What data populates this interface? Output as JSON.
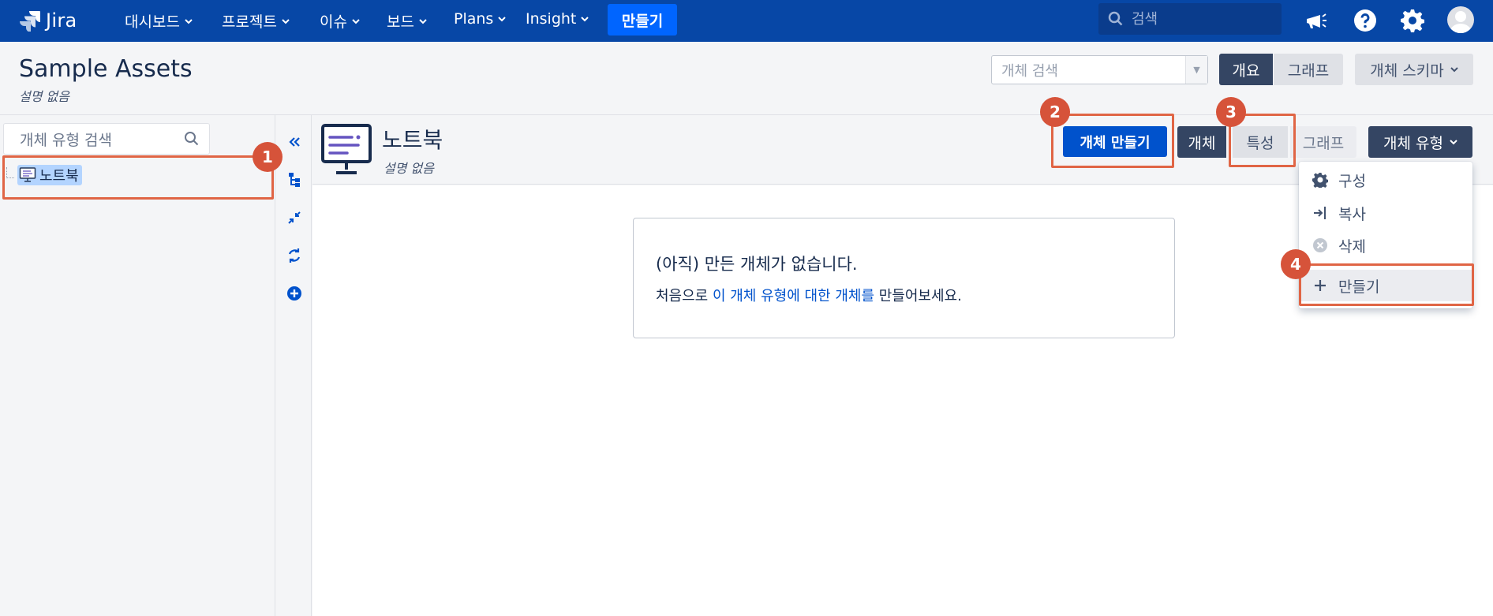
{
  "app": {
    "name": "Jira"
  },
  "topnav": {
    "items": [
      {
        "label": "대시보드"
      },
      {
        "label": "프로젝트"
      },
      {
        "label": "이슈"
      },
      {
        "label": "보드"
      },
      {
        "label": "Plans"
      },
      {
        "label": "Insight"
      }
    ],
    "create_label": "만들기",
    "search_placeholder": "검색"
  },
  "header": {
    "title": "Sample Assets",
    "subtitle": "설명 없음",
    "object_search_placeholder": "개체 검색",
    "view_overview": "개요",
    "view_graph": "그래프",
    "schema_label": "개체 스키마"
  },
  "sidebar": {
    "search_placeholder": "개체 유형 검색",
    "tree": [
      {
        "label": "노트북"
      }
    ]
  },
  "object_type": {
    "title": "노트북",
    "subtitle": "설명 없음",
    "create_object_label": "개체 만들기",
    "tabs": [
      {
        "label": "개체"
      },
      {
        "label": "특성"
      },
      {
        "label": "그래프"
      }
    ],
    "type_menu_label": "개체 유형"
  },
  "dropdown": {
    "items": [
      {
        "label": "구성",
        "icon": "gear-icon"
      },
      {
        "label": "복사",
        "icon": "copy-icon"
      },
      {
        "label": "삭제",
        "icon": "delete-icon"
      },
      {
        "label": "만들기",
        "icon": "plus-icon"
      }
    ]
  },
  "empty_state": {
    "title": "(아직) 만든 개체가 없습니다.",
    "desc_prefix": "처음으로 ",
    "desc_link": "이 개체 유형에 대한 개체를",
    "desc_suffix": " 만들어보세요."
  },
  "annotations": [
    "1",
    "2",
    "3",
    "4"
  ],
  "colors": {
    "nav_bg": "#0747a6",
    "primary": "#0052cc",
    "annotation": "#d6533a"
  }
}
